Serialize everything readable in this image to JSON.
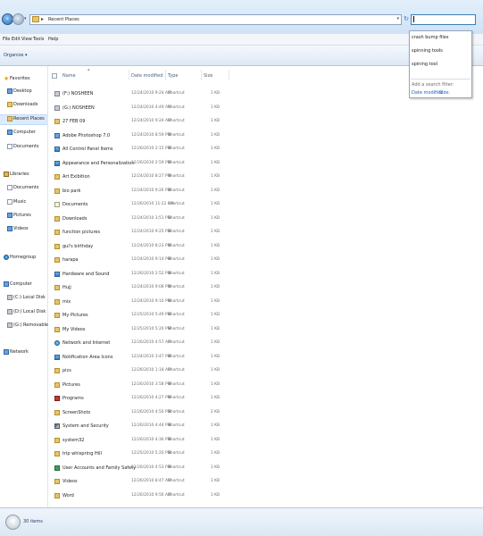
{
  "address": {
    "path": "Recent Places",
    "separator": "▸"
  },
  "search": {
    "value": "",
    "suggestions": [
      "crash bump files",
      "spinning tools",
      "spining tool"
    ],
    "filter_label": "Add a search filter:",
    "filters": [
      "Date modified:",
      "Size:"
    ]
  },
  "menu": [
    "File",
    "Edit",
    "View",
    "Tools",
    "Help"
  ],
  "commandbar": {
    "organize": "Organize ▾"
  },
  "navpane": {
    "favorites": {
      "label": "Favorites",
      "items": [
        "Desktop",
        "Downloads",
        "Recent Places"
      ]
    },
    "computer_top": "Computer",
    "documents_top": "Documents",
    "libraries": {
      "label": "Libraries",
      "items": [
        "Documents",
        "Music",
        "Pictures",
        "Videos"
      ]
    },
    "homegroup": "Homegroup",
    "computer": {
      "label": "Computer",
      "items": [
        "(C:) Local Disk",
        "(D:) Local Disk",
        "(G:) Removable Disk"
      ]
    },
    "network": "Network"
  },
  "columns": {
    "name": "Name",
    "date": "Date modified",
    "type": "Type",
    "size": "Size"
  },
  "files": [
    {
      "name": "(F:) NOSHEEN",
      "date": "12/24/2010 9:24 AM",
      "type": "Shortcut",
      "size": "1 KB",
      "icon": "drive-icon"
    },
    {
      "name": "(G:) NOSHEEN",
      "date": "12/24/2010 4:49 AM",
      "type": "Shortcut",
      "size": "1 KB",
      "icon": "drive-icon"
    },
    {
      "name": "27 FEB 09",
      "date": "12/24/2010 9:24 AM",
      "type": "Shortcut",
      "size": "1 KB",
      "icon": "folder-icon"
    },
    {
      "name": "Adobe Photoshop 7.0",
      "date": "12/24/2010 8:59 PM",
      "type": "Shortcut",
      "size": "1 KB",
      "icon": "photoshop-icon"
    },
    {
      "name": "All Control Panel Items",
      "date": "12/26/2010 2:15 PM",
      "type": "Shortcut",
      "size": "1 KB",
      "icon": "control-panel-icon"
    },
    {
      "name": "Appearance and Personalization",
      "date": "12/26/2010 2:59 PM",
      "type": "Shortcut",
      "size": "1 KB",
      "icon": "personalization-icon"
    },
    {
      "name": "Art Exibition",
      "date": "12/24/2010 8:27 PM",
      "type": "Shortcut",
      "size": "1 KB",
      "icon": "folder-icon"
    },
    {
      "name": "bio park",
      "date": "12/24/2010 9:26 PM",
      "type": "Shortcut",
      "size": "1 KB",
      "icon": "folder-icon"
    },
    {
      "name": "Documents",
      "date": "12/26/2010 11:22 AM",
      "type": "Shortcut",
      "size": "1 KB",
      "icon": "documents-icon"
    },
    {
      "name": "Downloads",
      "date": "12/24/2010 3:51 PM",
      "type": "Shortcut",
      "size": "1 KB",
      "icon": "folder-icon"
    },
    {
      "name": "function pictures",
      "date": "12/24/2010 9:25 PM",
      "type": "Shortcut",
      "size": "1 KB",
      "icon": "folder-icon"
    },
    {
      "name": "gul's birthday",
      "date": "12/24/2010 8:23 PM",
      "type": "Shortcut",
      "size": "1 KB",
      "icon": "folder-icon"
    },
    {
      "name": "harapa",
      "date": "12/24/2010 9:14 PM",
      "type": "Shortcut",
      "size": "1 KB",
      "icon": "folder-icon"
    },
    {
      "name": "Hardware and Sound",
      "date": "12/26/2010 2:52 PM",
      "type": "Shortcut",
      "size": "1 KB",
      "icon": "control-panel-icon"
    },
    {
      "name": "Hujj",
      "date": "12/24/2010 9:08 PM",
      "type": "Shortcut",
      "size": "1 KB",
      "icon": "folder-icon"
    },
    {
      "name": "mix",
      "date": "12/24/2010 9:10 PM",
      "type": "Shortcut",
      "size": "1 KB",
      "icon": "folder-icon"
    },
    {
      "name": "My Pictures",
      "date": "12/25/2010 5:49 PM",
      "type": "Shortcut",
      "size": "1 KB",
      "icon": "folder-icon"
    },
    {
      "name": "My Videos",
      "date": "12/25/2010 5:20 PM",
      "type": "Shortcut",
      "size": "1 KB",
      "icon": "folder-icon"
    },
    {
      "name": "Network and Internet",
      "date": "12/26/2010 4:57 AM",
      "type": "Shortcut",
      "size": "1 KB",
      "icon": "network-icon"
    },
    {
      "name": "Notification Area Icons",
      "date": "12/24/2010 3:47 PM",
      "type": "Shortcut",
      "size": "1 KB",
      "icon": "control-panel-icon"
    },
    {
      "name": "pics",
      "date": "12/26/2010 1:18 AM",
      "type": "Shortcut",
      "size": "1 KB",
      "icon": "folder-icon"
    },
    {
      "name": "Pictures",
      "date": "12/26/2010 3:58 PM",
      "type": "Shortcut",
      "size": "1 KB",
      "icon": "folder-icon"
    },
    {
      "name": "Programs",
      "date": "12/26/2010 4:27 PM",
      "type": "Shortcut",
      "size": "1 KB",
      "icon": "programs-icon"
    },
    {
      "name": "ScreenShots",
      "date": "12/26/2010 4:50 PM",
      "type": "Shortcut",
      "size": "2 KB",
      "icon": "folder-icon"
    },
    {
      "name": "System and Security",
      "date": "12/26/2010 4:44 PM",
      "type": "Shortcut",
      "size": "1 KB",
      "icon": "shield-icon"
    },
    {
      "name": "system32",
      "date": "12/26/2010 4:36 PM",
      "type": "Shortcut",
      "size": "1 KB",
      "icon": "folder-icon"
    },
    {
      "name": "trip whispring Hill",
      "date": "12/25/2010 5:20 PM",
      "type": "Shortcut",
      "size": "1 KB",
      "icon": "folder-icon"
    },
    {
      "name": "User Accounts and Family Safety",
      "date": "12/26/2010 4:53 PM",
      "type": "Shortcut",
      "size": "1 KB",
      "icon": "user-accounts-icon"
    },
    {
      "name": "Videos",
      "date": "12/26/2010 8:47 AM",
      "type": "Shortcut",
      "size": "1 KB",
      "icon": "folder-icon"
    },
    {
      "name": "Word",
      "date": "12/26/2010 9:56 AM",
      "type": "Shortcut",
      "size": "1 KB",
      "icon": "folder-icon"
    }
  ],
  "status": {
    "count": "30 items"
  }
}
